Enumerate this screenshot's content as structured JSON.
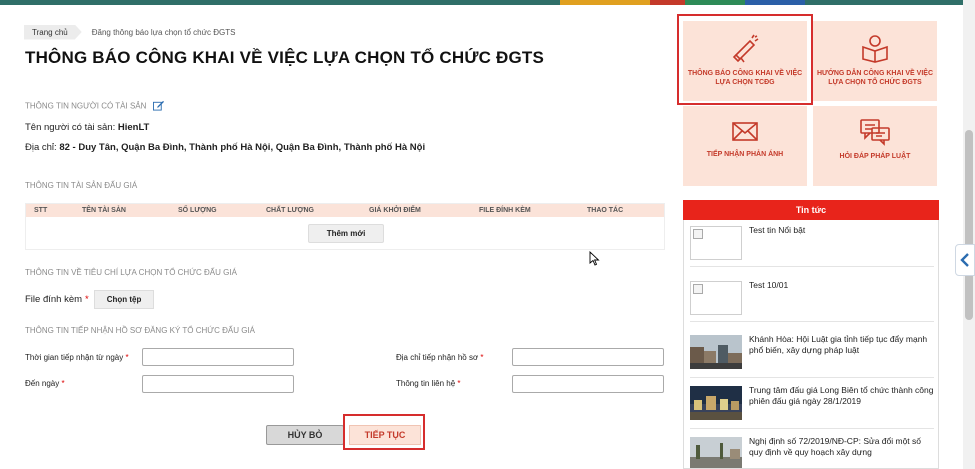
{
  "breadcrumb": {
    "home": "Trang chủ",
    "current": "Đăng thông báo lựa chọn tổ chức ĐGTS"
  },
  "page_title": "THÔNG BÁO CÔNG KHAI VỀ VIỆC LỰA CHỌN TỔ CHỨC ĐGTS",
  "owner_section": {
    "label": "THÔNG TIN NGƯỜI CÓ TÀI SẢN",
    "name_label": "Tên người có tài sản: ",
    "name_value": "HienLT",
    "address_label": "Địa chỉ: ",
    "address_value": "82 - Duy Tân, Quận Ba Đình, Thành phố Hà Nội, Quận Ba Đình, Thành phố Hà Nội"
  },
  "asset_section": {
    "label": "THÔNG TIN TÀI SẢN ĐẤU GIÁ",
    "columns": [
      "STT",
      "TÊN TÀI SẢN",
      "SỐ LƯỢNG",
      "CHẤT LƯỢNG",
      "GIÁ KHỞI ĐIỂM",
      "FILE ĐÍNH KÈM",
      "THAO TÁC"
    ],
    "add_button": "Thêm mới"
  },
  "criteria_section": {
    "label": "THÔNG TIN VỀ TIÊU CHÍ LỰA CHỌN TỔ CHỨC ĐẤU GIÁ",
    "file_label": "File đính kèm",
    "required_mark": "*",
    "choose_button": "Chọn tệp"
  },
  "receipt_section": {
    "label": "THÔNG TIN TIẾP NHẬN HỒ SƠ ĐĂNG KÝ TỔ CHỨC ĐẤU GIÁ",
    "from_label": "Thời gian tiếp nhận từ ngày",
    "to_label": "Đến ngày",
    "address_label": "Địa chỉ tiếp nhận hồ sơ",
    "contact_label": "Thông tin liên hệ",
    "required_mark": "*"
  },
  "actions": {
    "cancel": "HỦY BỎ",
    "continue": "TIẾP TỤC"
  },
  "tiles": [
    {
      "label": "THÔNG BÁO CÔNG KHAI VỀ VIỆC LỰA CHỌN TCĐG",
      "icon": "megaphone-icon"
    },
    {
      "label": "HƯỚNG DẪN CÔNG KHAI VỀ VIỆC LỰA CHỌN TỔ CHỨC ĐGTS",
      "icon": "reader-book-icon"
    },
    {
      "label": "TIẾP NHẬN PHẢN ÁNH",
      "icon": "envelope-icon"
    },
    {
      "label": "HỎI ĐÁP PHÁP LUẬT",
      "icon": "chat-bubbles-icon"
    }
  ],
  "news": {
    "heading": "Tin tức",
    "items": [
      {
        "title": "Test tin Nổi bật"
      },
      {
        "title": "Test 10/01"
      },
      {
        "title": "Khánh Hòa: Hội Luật gia tỉnh tiếp tục đẩy mạnh phổ biến, xây dựng pháp luật"
      },
      {
        "title": "Trung tâm đấu giá Long Biên tổ chức thành công phiên đấu giá ngày 28/1/2019"
      },
      {
        "title": "Nghị định số 72/2019/NĐ-CP: Sửa đổi một số quy định về quy hoạch xây dựng"
      }
    ]
  },
  "colors": {
    "accent": "#c43a2a",
    "tile_bg": "#fce3d8",
    "news_header": "#e8241b",
    "highlight": "#d62d2d"
  }
}
